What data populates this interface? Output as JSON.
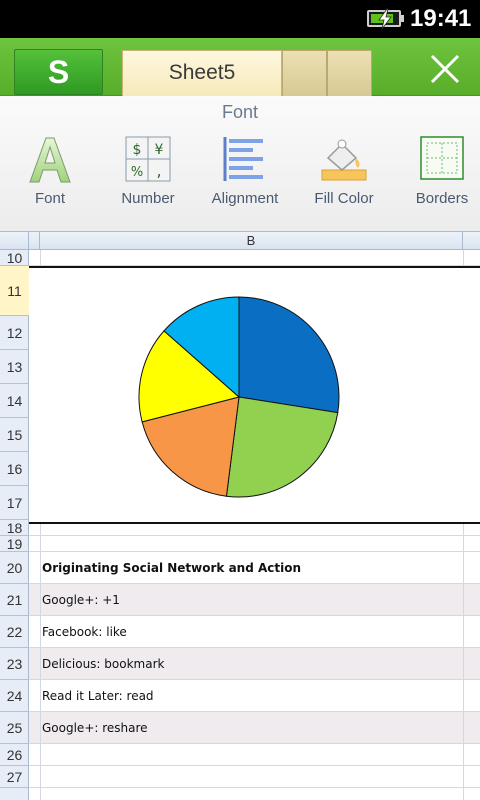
{
  "status_bar": {
    "time": "19:41",
    "battery_level": 0.85
  },
  "title_bar": {
    "app_button_label": "S",
    "active_tab": "Sheet5",
    "inactive_tab_count": 2
  },
  "font_panel": {
    "title": "Font",
    "tools": [
      {
        "label": "Font",
        "icon": "font-a-icon"
      },
      {
        "label": "Number",
        "icon": "number-format-icon"
      },
      {
        "label": "Alignment",
        "icon": "alignment-icon"
      },
      {
        "label": "Fill Color",
        "icon": "fill-color-icon"
      },
      {
        "label": "Borders",
        "icon": "borders-icon"
      }
    ]
  },
  "sheet": {
    "column_header": "B",
    "rows": [
      "10",
      "11",
      "12",
      "13",
      "14",
      "15",
      "16",
      "17",
      "18",
      "19",
      "20",
      "21",
      "22",
      "23",
      "24",
      "25",
      "26",
      "27"
    ],
    "selected_row": "11",
    "cells": {
      "r20": "Originating Social Network and Action",
      "r21": "Google+: +1",
      "r22": "Facebook: like",
      "r23": "Delicious: bookmark",
      "r24": "Read it Later: read",
      "r25": "Google+: reshare"
    }
  },
  "chart_data": {
    "type": "pie",
    "title": "",
    "slices": [
      {
        "name": "Google+: +1",
        "value": 27.5,
        "color": "#0a6fc2"
      },
      {
        "name": "Facebook: like",
        "value": 24.5,
        "color": "#92d050"
      },
      {
        "name": "Delicious: bookmark",
        "value": 19.0,
        "color": "#f79646"
      },
      {
        "name": "Read it Later: read",
        "value": 15.5,
        "color": "#ffff00"
      },
      {
        "name": "Google+: reshare",
        "value": 13.5,
        "color": "#00b0f0"
      }
    ]
  }
}
